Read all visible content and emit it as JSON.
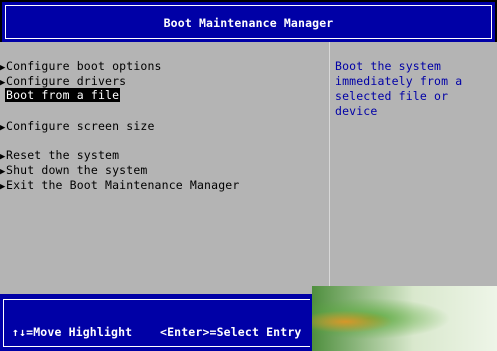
{
  "header": {
    "title": "Boot Maintenance Manager"
  },
  "menu": {
    "items": [
      {
        "label": "Configure boot options",
        "arrow": "▶",
        "selected": false
      },
      {
        "label": "Configure drivers",
        "arrow": "▶",
        "selected": false
      },
      {
        "label": "Boot from a file",
        "arrow": "",
        "selected": true
      },
      {
        "label": "Configure screen size",
        "arrow": "▶",
        "selected": false
      },
      {
        "label": "Reset the system",
        "arrow": "▶",
        "selected": false
      },
      {
        "label": "Shut down the system",
        "arrow": "▶",
        "selected": false
      },
      {
        "label": "Exit the Boot Maintenance Manager",
        "arrow": "▶",
        "selected": false
      }
    ]
  },
  "help": {
    "text": "Boot the system\nimmediately from a\nselected file or device"
  },
  "footer": {
    "move_hint": "↑↓=Move Highlight",
    "select_hint": "<Enter>=Select Entry"
  },
  "colors": {
    "frame_blue": "#0000a6",
    "body_gray": "#b4b4b4",
    "selection_bg": "#000000",
    "help_text": "#0000a6"
  }
}
